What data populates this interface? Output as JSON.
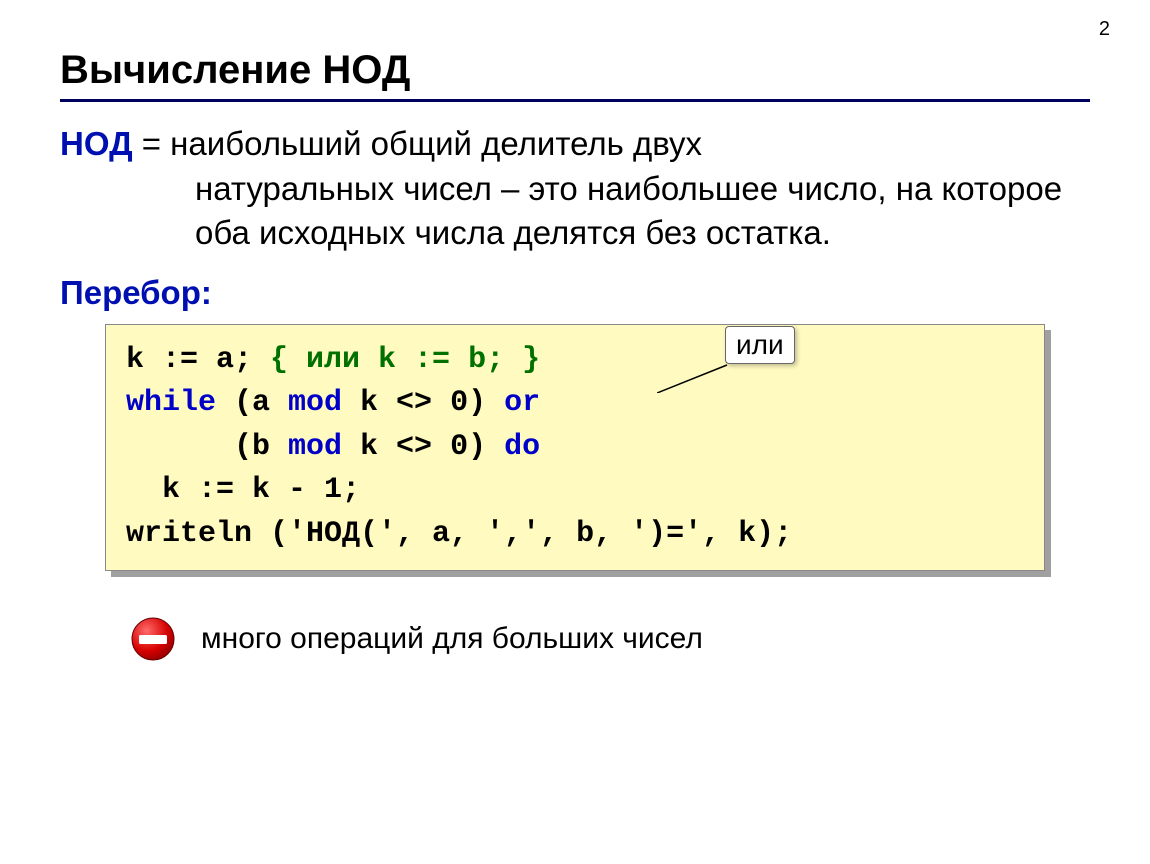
{
  "page_number": "2",
  "title": "Вычисление НОД",
  "definition": {
    "term": "НОД",
    "line1": " = наибольший общий делитель двух",
    "cont": "натуральных чисел – это наибольшее число, на которое оба исходных числа делятся без остатка."
  },
  "section_label": "Перебор:",
  "callout_label": "или",
  "code": {
    "l1_a": "k := a; ",
    "l1_c": "{ или k := b; }",
    "l2_a": "while",
    "l2_b": " (a ",
    "l2_c": "mod",
    "l2_d": " k <> 0) ",
    "l2_e": "or",
    "l3_a": "      (b ",
    "l3_b": "mod",
    "l3_c": " k <> 0) ",
    "l3_d": "do",
    "l4": "  k := k - 1;",
    "l5": "writeln ('НОД(', a, ',', b, ')=', k);"
  },
  "note_text": "много операций для больших чисел"
}
